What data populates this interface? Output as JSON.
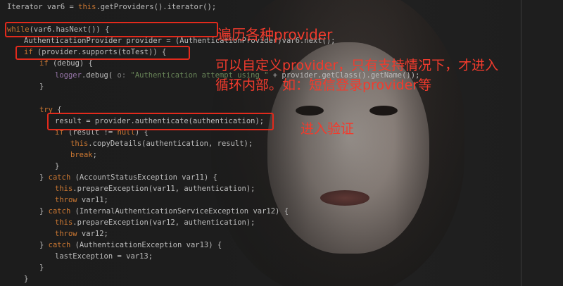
{
  "code": {
    "lines": [
      {
        "id": "l01",
        "text": "Iterator var6 = this.getProviders().iterator();"
      },
      {
        "id": "l02",
        "text": "while(var6.hasNext()) {"
      },
      {
        "id": "l03",
        "text": "AuthenticationProvider provider = (AuthenticationProvider)var6.next();"
      },
      {
        "id": "l04",
        "text": "if (provider.supports(toTest)) {"
      },
      {
        "id": "l05",
        "text": "if (debug) {"
      },
      {
        "id": "l06",
        "text": "logger.debug( o: \"Authentication attempt using \" + provider.getClass().getName());"
      },
      {
        "id": "l07",
        "text": "}"
      },
      {
        "id": "l08",
        "text": "try {"
      },
      {
        "id": "l09",
        "text": "result = provider.authenticate(authentication);"
      },
      {
        "id": "l10",
        "text": "if (result != null) {"
      },
      {
        "id": "l11",
        "text": "this.copyDetails(authentication, result);"
      },
      {
        "id": "l12",
        "text": "break;"
      },
      {
        "id": "l13",
        "text": "}"
      },
      {
        "id": "l14",
        "text": "} catch (AccountStatusException var11) {"
      },
      {
        "id": "l15",
        "text": "this.prepareException(var11, authentication);"
      },
      {
        "id": "l16",
        "text": "throw var11;"
      },
      {
        "id": "l17",
        "text": "} catch (InternalAuthenticationServiceException var12) {"
      },
      {
        "id": "l18",
        "text": "this.prepareException(var12, authentication);"
      },
      {
        "id": "l19",
        "text": "throw var12;"
      },
      {
        "id": "l20",
        "text": "} catch (AuthenticationException var13) {"
      },
      {
        "id": "l21",
        "text": "lastException = var13;"
      },
      {
        "id": "l22",
        "text": "}"
      },
      {
        "id": "l23",
        "text": "}"
      }
    ]
  },
  "annotations": {
    "loop_note": "遍历各种provider",
    "supports_note_line1": "可以自定义provider，只有支持情况下，才进入",
    "supports_note_line2": "循环内部。如：短信登录provider等",
    "auth_note": "进入验证"
  },
  "colors": {
    "annotation_red": "#e22a1c",
    "keyword": "#cc7832",
    "field": "#9876aa",
    "string": "#6a8759",
    "method": "#ffc66d",
    "plain": "#bcbcbc"
  }
}
